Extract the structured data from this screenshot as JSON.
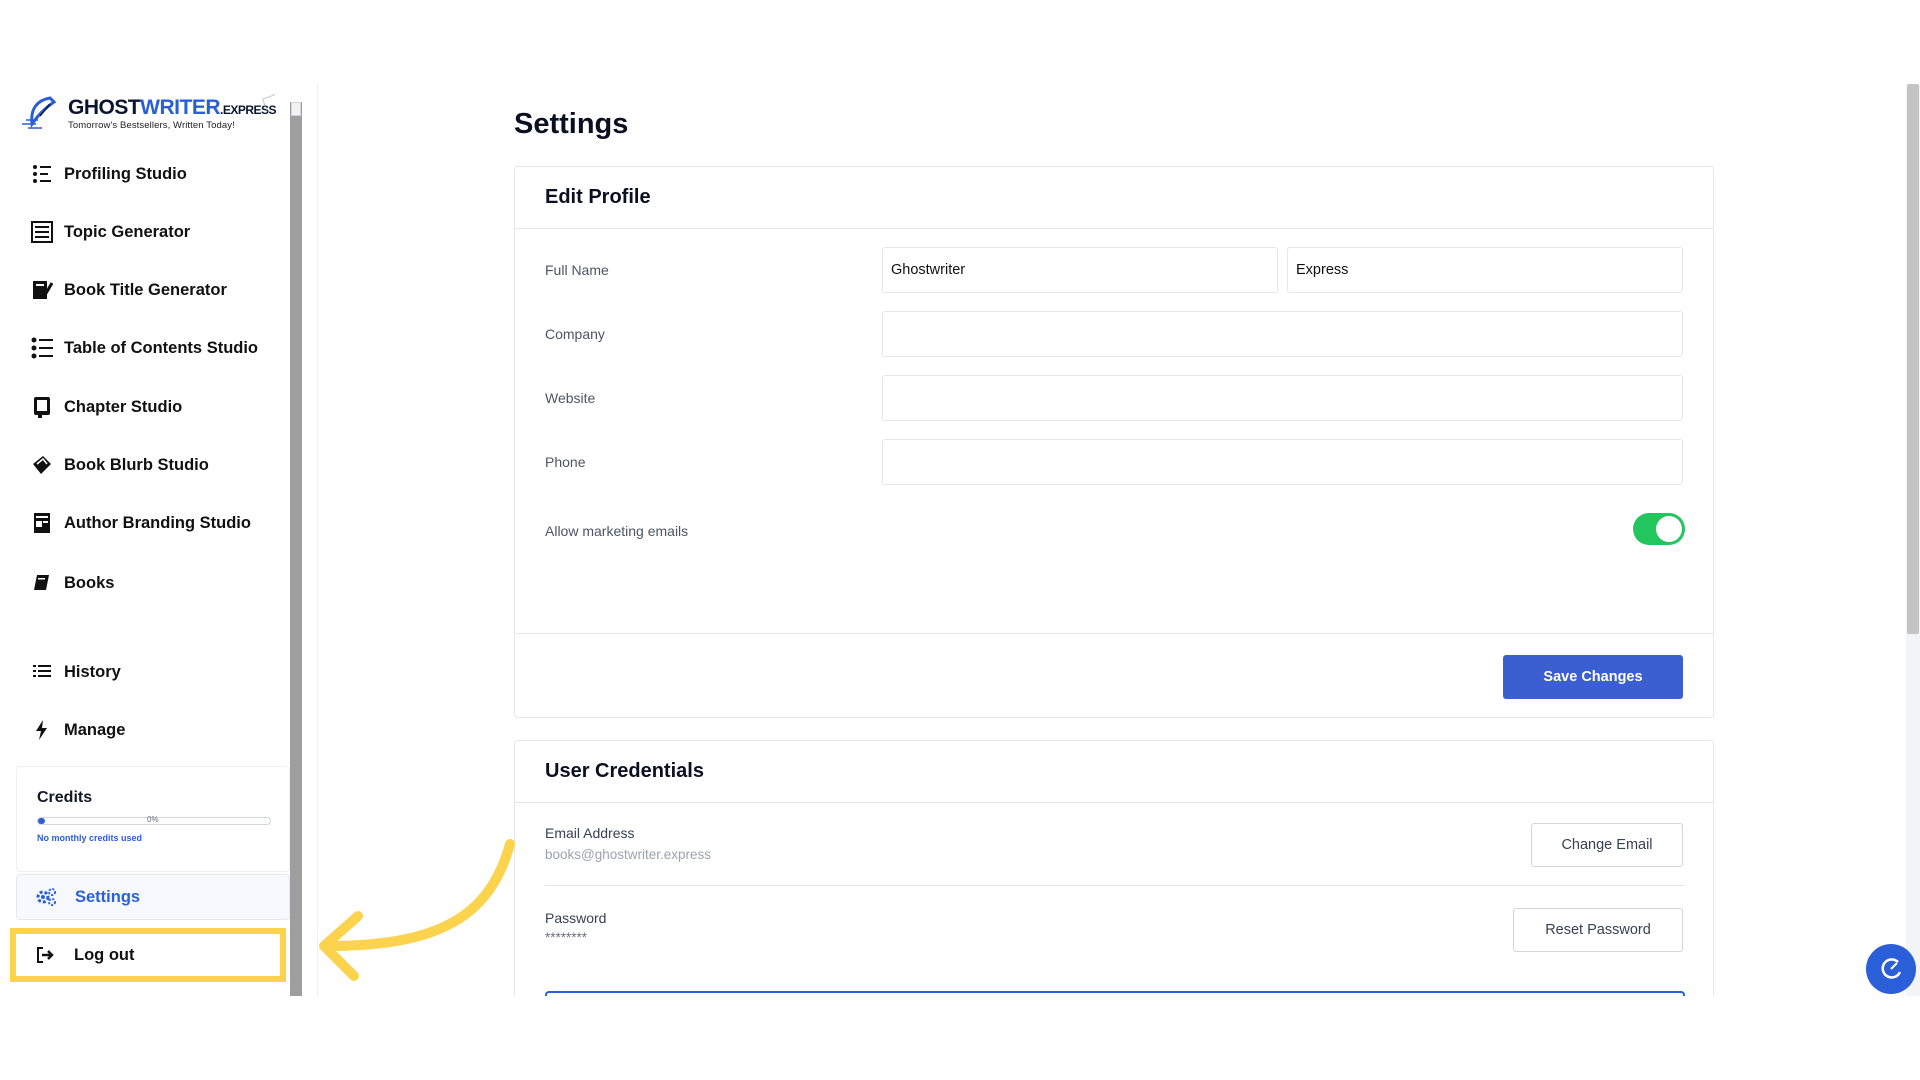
{
  "brand": {
    "name_part1": "GHOST",
    "name_part2": "WRITER",
    "name_suffix": ".EXPRESS",
    "tagline": "Tomorrow's Bestsellers, Written Today!"
  },
  "sidebar": {
    "items": [
      {
        "label": "Profiling Studio",
        "icon": "profiling-icon"
      },
      {
        "label": "Topic Generator",
        "icon": "topic-icon"
      },
      {
        "label": "Book Title Generator",
        "icon": "book-title-icon"
      },
      {
        "label": "Table of Contents Studio",
        "icon": "toc-icon"
      },
      {
        "label": "Chapter Studio",
        "icon": "chapter-icon"
      },
      {
        "label": "Book Blurb Studio",
        "icon": "blurb-icon"
      },
      {
        "label": "Author Branding Studio",
        "icon": "branding-icon"
      },
      {
        "label": "Books",
        "icon": "books-icon"
      },
      {
        "label": "History",
        "icon": "list-icon"
      },
      {
        "label": "Manage",
        "icon": "bolt-icon"
      }
    ],
    "credits": {
      "title": "Credits",
      "percent_label": "0%",
      "usage_fraction": 0.03,
      "note": "No monthly credits used"
    },
    "settings_label": "Settings",
    "logout_label": "Log out"
  },
  "page": {
    "title": "Settings"
  },
  "edit_profile": {
    "title": "Edit Profile",
    "full_name_label": "Full Name",
    "first_name_value": "Ghostwriter",
    "last_name_value": "Express",
    "company_label": "Company",
    "company_value": "",
    "website_label": "Website",
    "website_value": "",
    "phone_label": "Phone",
    "phone_value": "",
    "marketing_label": "Allow marketing emails",
    "marketing_enabled": true,
    "save_label": "Save Changes"
  },
  "credentials": {
    "title": "User Credentials",
    "email_label": "Email Address",
    "email_value": "books@ghostwriter.express",
    "change_email_label": "Change Email",
    "password_label": "Password",
    "password_value": "********",
    "reset_password_label": "Reset Password"
  },
  "colors": {
    "accent": "#2b5fd9",
    "toggle_on": "#22c55e",
    "highlight": "#fcd34d"
  }
}
